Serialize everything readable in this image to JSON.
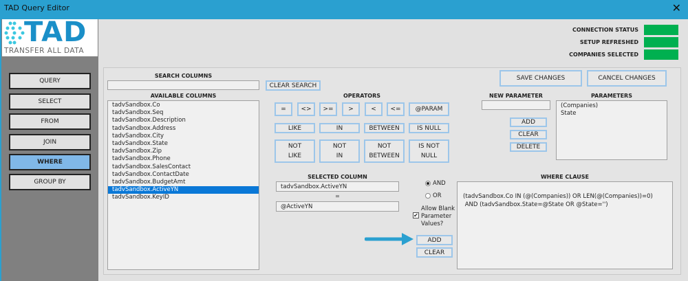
{
  "window": {
    "title": "TAD Query Editor",
    "close": "✕"
  },
  "logo": {
    "text": "TAD",
    "tagline": "TRANSFER ALL DATA"
  },
  "nav": [
    {
      "label": "QUERY"
    },
    {
      "label": "SELECT"
    },
    {
      "label": "FROM"
    },
    {
      "label": "JOIN"
    },
    {
      "label": "WHERE",
      "active": true
    },
    {
      "label": "GROUP BY"
    }
  ],
  "status": [
    {
      "label": "CONNECTION STATUS",
      "color": "#00b050"
    },
    {
      "label": "SETUP REFRESHED",
      "color": "#00b050"
    },
    {
      "label": "COMPANIES SELECTED",
      "color": "#00b050"
    }
  ],
  "search": {
    "label": "SEARCH COLUMNS",
    "value": "",
    "clear": "CLEAR SEARCH"
  },
  "available": {
    "label": "AVAILABLE COLUMNS",
    "items": [
      "tadvSandbox.Co",
      "tadvSandbox.Seq",
      "tadvSandbox.Description",
      "tadvSandbox.Address",
      "tadvSandbox.City",
      "tadvSandbox.State",
      "tadvSandbox.Zip",
      "tadvSandbox.Phone",
      "tadvSandbox.SalesContact",
      "tadvSandbox.ContactDate",
      "tadvSandbox.BudgetAmt",
      "tadvSandbox.ActiveYN",
      "tadvSandbox.KeyID"
    ],
    "selected": "tadvSandbox.ActiveYN"
  },
  "operators": {
    "label": "OPERATORS",
    "row1": [
      "=",
      "<>",
      ">=",
      ">",
      "<",
      "<=",
      "@PARAM"
    ],
    "row2": [
      "LIKE",
      "IN",
      "BETWEEN",
      "IS NULL"
    ],
    "row3": [
      [
        "NOT",
        "LIKE"
      ],
      [
        "NOT",
        "IN"
      ],
      [
        "NOT",
        "BETWEEN"
      ],
      [
        "IS NOT",
        "NULL"
      ]
    ]
  },
  "actions": {
    "save": "SAVE CHANGES",
    "cancel": "CANCEL CHANGES"
  },
  "new_parameter": {
    "label": "NEW PARAMETER",
    "value": "",
    "add": "ADD",
    "clear": "CLEAR",
    "delete": "DELETE"
  },
  "parameters": {
    "label": "PARAMETERS",
    "items": [
      "(Companies)",
      "State"
    ]
  },
  "selected_column": {
    "label": "SELECTED COLUMN",
    "value": "tadvSandbox.ActiveYN",
    "operator": "=",
    "param": "@ActiveYN"
  },
  "logic": {
    "and": "AND",
    "or": "OR",
    "selected": "AND",
    "allow_blank": "Allow Blank Parameter Values?",
    "allow_blank_checked": true,
    "add": "ADD",
    "clear": "CLEAR"
  },
  "where": {
    "label": "WHERE CLAUSE",
    "lines": [
      "(tadvSandbox.Co IN (@(Companies)) OR LEN(@(Companies))=0)",
      " AND (tadvSandbox.State=@State OR @State='')"
    ]
  }
}
